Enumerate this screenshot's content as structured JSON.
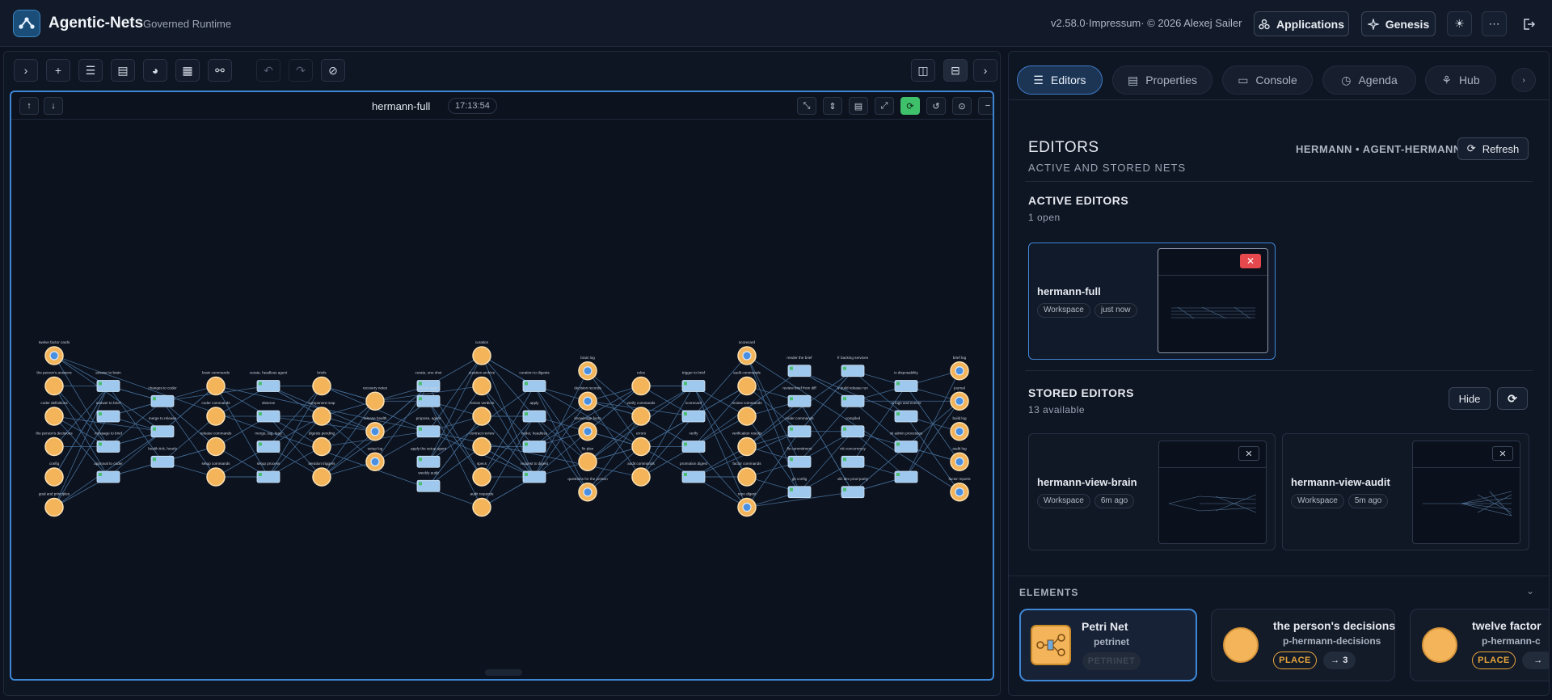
{
  "header": {
    "app_title": "Agentic-Nets",
    "app_subtitle": "Governed Runtime",
    "version_text": "v2.58.0·Impressum· © 2026 Alexej Sailer",
    "applications_label": "Applications",
    "genesis_label": "Genesis"
  },
  "canvas": {
    "net_title": "hermann-full",
    "timestamp": "17:13:54"
  },
  "net_labels": {
    "col1": [
      "twelve factor cards",
      "the person's answers",
      "coder definitions",
      "the person's decisions",
      "config",
      "goal and principles"
    ],
    "col2": [
      "answer to brain",
      "answer to brief",
      "message to brief",
      "approval to coder"
    ],
    "col3": [
      "changes to coder",
      "merge to release",
      "health tick, hourly"
    ],
    "col4": [
      "brain commands",
      "coder commands",
      "release commands",
      "setup commands"
    ],
    "col5": [
      "curate, headless agent",
      "observe",
      "merge, tag, load",
      "setup process"
    ],
    "col6": [
      "briefs",
      "component map",
      "digests pending",
      "iteration triggers"
    ],
    "col7": [
      "recovery notes",
      "release health",
      "setup log"
    ],
    "col8": [
      "curate, one shot",
      "review agent",
      "propose, agent",
      "apply the setup agent",
      "weekly audit"
    ],
    "col9": [
      "curation",
      "curation archive",
      "review verdicts",
      "contract review",
      "specs",
      "audit requests"
    ],
    "col10": [
      "curation to digests",
      "apply",
      "coder, headless",
      "request to digest"
    ],
    "col11": [
      "brain log",
      "decision records",
      "knowledge facts",
      "fix plan",
      "questions for the person"
    ],
    "col12": [
      "rules",
      "verify commands",
      "errors",
      "audit commands"
    ],
    "col13": [
      "trigger to brief",
      "scorecard",
      "verify",
      "promotion digest"
    ],
    "col14": [
      "scorecard",
      "audit commands",
      "review commands",
      "verification results",
      "factor commands",
      "repo digest"
    ],
    "col15": [
      "render the brief",
      "review brief from diff",
      "coder commands",
      "fix commitment",
      "git config"
    ],
    "col16": [
      "fr backing services",
      "v build release run",
      "compiled",
      "viii concurrency",
      "viiii dev prod parity"
    ],
    "col17": [
      "ix disposability",
      "xi logs and events",
      "xii admin processes"
    ],
    "col18": [
      "brief log",
      "journal",
      "build log",
      "audit log",
      "factor reports"
    ]
  },
  "tabs": [
    {
      "label": "Editors",
      "icon": "list-icon"
    },
    {
      "label": "Properties",
      "icon": "document-icon"
    },
    {
      "label": "Console",
      "icon": "terminal-icon"
    },
    {
      "label": "Agenda",
      "icon": "clock-icon"
    },
    {
      "label": "Hub",
      "icon": "hub-icon"
    }
  ],
  "editors": {
    "title": "EDITORS",
    "subtitle": "ACTIVE AND STORED NETS",
    "context": "HERMANN • AGENT-HERMANN",
    "refresh_label": "Refresh",
    "active_heading": "ACTIVE EDITORS",
    "active_count": "1 open",
    "active": [
      {
        "name": "hermann-full",
        "tag": "Workspace",
        "time": "just now"
      }
    ],
    "stored_heading": "STORED EDITORS",
    "stored_count": "13 available",
    "hide_label": "Hide",
    "stored": [
      {
        "name": "hermann-view-brain",
        "tag": "Workspace",
        "time": "6m ago"
      },
      {
        "name": "hermann-view-audit",
        "tag": "Workspace",
        "time": "5m ago"
      }
    ]
  },
  "elements": {
    "heading": "ELEMENTS",
    "items": [
      {
        "title": "Petri Net",
        "subtitle": "petrinet",
        "tag": "PETRINET"
      },
      {
        "title": "the person's decisions",
        "subtitle": "p-hermann-decisions",
        "tag": "PLACE",
        "count": "→ 3"
      },
      {
        "title": "twelve factor",
        "subtitle": "p-hermann-c",
        "tag": "PLACE",
        "count": "→"
      }
    ]
  },
  "colors": {
    "accent": "#3e87d6",
    "place": "#f3b45a",
    "transition": "#9ec8ee",
    "place_tag": "#e8a53c",
    "close_red": "#e5484d"
  }
}
